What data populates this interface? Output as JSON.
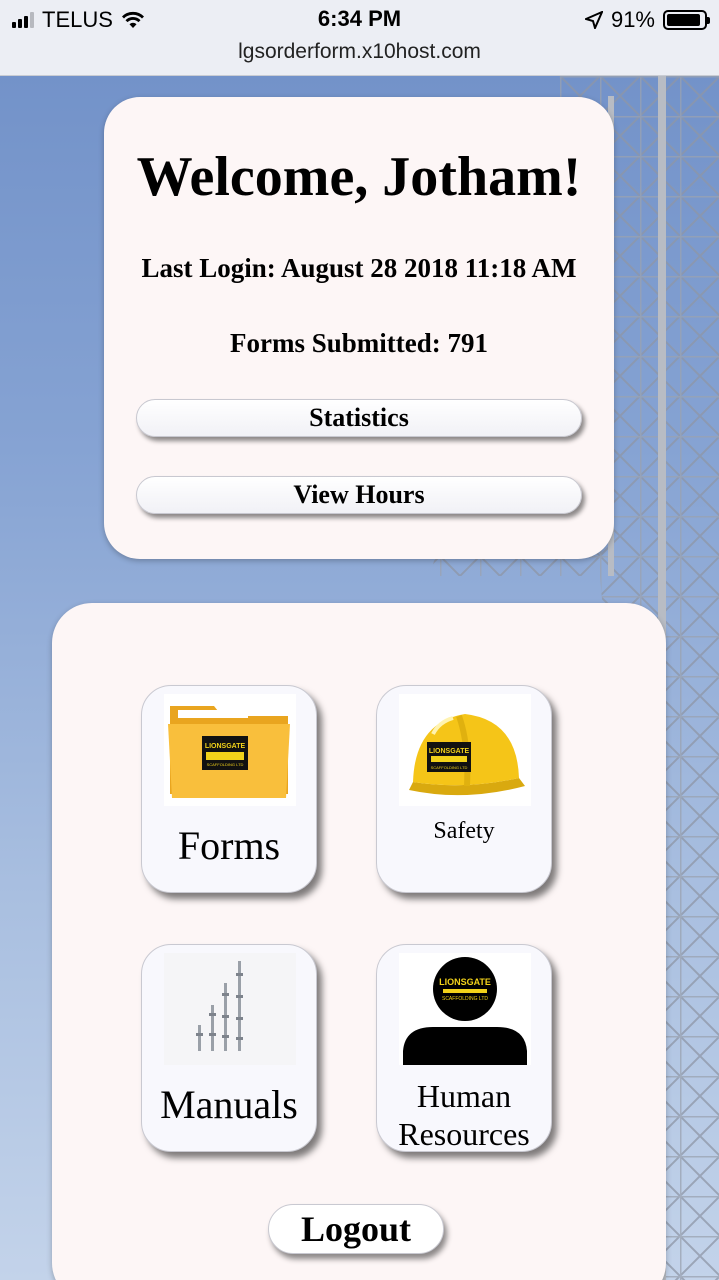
{
  "status_bar": {
    "carrier": "TELUS",
    "time": "6:34 PM",
    "battery": "91%",
    "signal_icon": "signal-bars-icon",
    "wifi_icon": "wifi-icon",
    "location_icon": "location-arrow-icon",
    "battery_icon": "battery-icon"
  },
  "browser": {
    "url": "lgsorderform.x10host.com"
  },
  "welcome": {
    "title": "Welcome, Jotham!",
    "last_login": "Last Login: August 28 2018 11:18 AM",
    "forms_submitted": "Forms Submitted: 791",
    "statistics_label": "Statistics",
    "view_hours_label": "View Hours"
  },
  "menu": {
    "tiles": [
      {
        "label": "Forms",
        "icon": "folder-icon"
      },
      {
        "label": "Safety",
        "icon": "hard-hat-icon"
      },
      {
        "label": "Manuals",
        "icon": "scaffold-poles-icon"
      },
      {
        "label_line1": "Human",
        "label_line2": "Resources",
        "icon": "person-icon"
      }
    ],
    "logout_label": "Logout"
  },
  "brand": {
    "logo_text": "LIONSGATE",
    "logo_sub": "SCAFFOLDING LTD"
  },
  "colors": {
    "card_bg": "#fdf6f6",
    "sky_top": "#6f8fc7",
    "logo_yellow": "#f2d21a",
    "folder": "#f7b733",
    "hardhat": "#f5c518"
  }
}
